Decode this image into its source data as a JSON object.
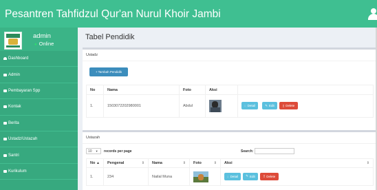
{
  "header": {
    "title": "Pesantren Tahfidzul Qur'an Nurul Khoir Jambi",
    "user_icon": "user-icon"
  },
  "sidebar": {
    "user": {
      "name": "admin",
      "status": "Online"
    },
    "items": [
      {
        "label": "Dashboard",
        "icon": "home-icon"
      },
      {
        "label": "Admin",
        "icon": "table-icon"
      },
      {
        "label": "Pembayaran Spp",
        "icon": "table-icon"
      },
      {
        "label": "Kontak",
        "icon": "table-icon"
      },
      {
        "label": "Berita",
        "icon": "table-icon"
      },
      {
        "label": "Ustadz/Ustazah",
        "icon": "table-icon"
      },
      {
        "label": "Santri",
        "icon": "table-icon"
      },
      {
        "label": "Kurikulum",
        "icon": "table-icon"
      }
    ]
  },
  "main": {
    "page_title": "Tabel Pendidik",
    "ustadz": {
      "title": "Ustadz",
      "add_button": "+ Tambah Pendidik",
      "columns": [
        "No",
        "Nama",
        "Foto",
        "Aksi"
      ],
      "rows": [
        {
          "no": "1.",
          "nama": "1503072202980001",
          "foto": "Abdul",
          "detail": "Detail",
          "edit": "Edit",
          "delete": "Delete"
        }
      ]
    },
    "ustazah": {
      "title": "Ustazah",
      "length_value": "10",
      "length_text": "records per page",
      "search_label": "Search:",
      "columns": [
        "No",
        "Pengenal",
        "Nama",
        "Foto",
        "Aksi"
      ],
      "rows": [
        {
          "no": "1.",
          "pengenal": "234",
          "nama": "Nailal Muna",
          "detail": "Detail",
          "edit": "Edit",
          "delete": "Delete"
        }
      ]
    }
  },
  "colors": {
    "header": "#3fbf91",
    "sidebar": "#37a97f",
    "primary": "#3c8dbc",
    "info": "#5bc0de",
    "danger": "#dd4b39"
  }
}
